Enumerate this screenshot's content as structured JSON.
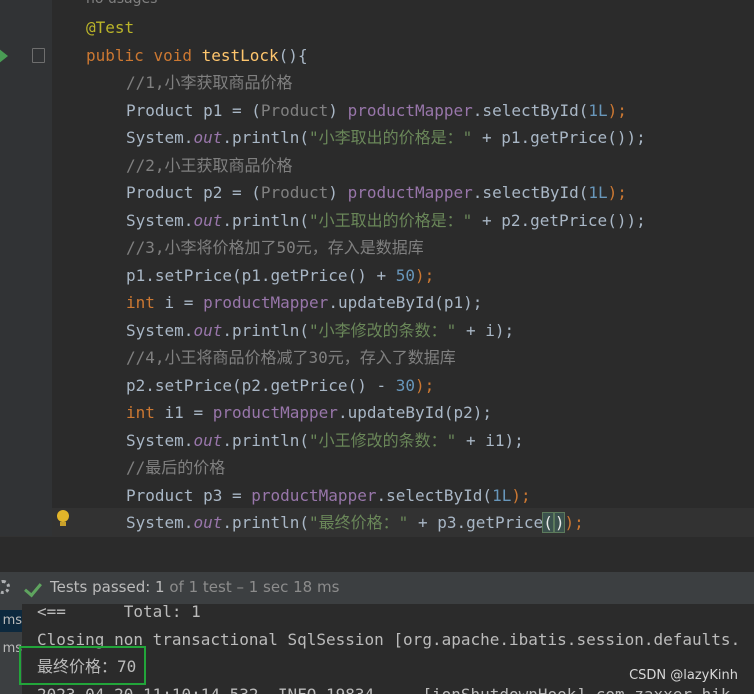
{
  "editor": {
    "hint": "no usages",
    "annotation": "@Test",
    "signature": {
      "kw_public": "public",
      "kw_void": "void",
      "method": "testLock",
      "open": "(){"
    },
    "comment1": "//1,小李获取商品价格",
    "line_p1": {
      "type": "Product p1 = (",
      "cast": "Product",
      "close": ") ",
      "mapper": "productMapper",
      "call": ".selectById(",
      "num": "1L",
      "end": ");"
    },
    "print_p1": {
      "sys": "System.",
      "out": "out",
      "call": ".println(",
      "str": "\"小李取出的价格是：\"",
      "rest": " + p1.getPrice());"
    },
    "comment2": "//2,小王获取商品价格",
    "line_p2": {
      "type": "Product p2 = (",
      "cast": "Product",
      "close": ") ",
      "mapper": "productMapper",
      "call": ".selectById(",
      "num": "1L",
      "end": ");"
    },
    "print_p2": {
      "sys": "System.",
      "out": "out",
      "call": ".println(",
      "str": "\"小王取出的价格是：\"",
      "rest": " + p2.getPrice());"
    },
    "comment3": "//3,小李将价格加了50元，存入是数据库",
    "set_p1": {
      "text": "p1.setPrice(p1.getPrice() + ",
      "num": "50",
      "end": ");"
    },
    "update_p1": {
      "kw": "int",
      "text": " i = ",
      "mapper": "productMapper",
      "rest": ".updateById(p1);"
    },
    "print_i": {
      "sys": "System.",
      "out": "out",
      "call": ".println(",
      "str": "\"小李修改的条数：\"",
      "rest": " + i);"
    },
    "comment4": "//4,小王将商品价格减了30元，存入了数据库",
    "set_p2": {
      "text": "p2.setPrice(p2.getPrice() - ",
      "num": "30",
      "end": ");"
    },
    "update_p2": {
      "kw": "int",
      "text": " i1 = ",
      "mapper": "productMapper",
      "rest": ".updateById(p2);"
    },
    "print_i1": {
      "sys": "System.",
      "out": "out",
      "call": ".println(",
      "str": "\"小王修改的条数：\"",
      "rest": " + i1);"
    },
    "comment5": "//最后的价格",
    "line_p3": {
      "text": "Product p3 = ",
      "mapper": "productMapper",
      "call": ".selectById(",
      "num": "1L",
      "end": ");"
    },
    "print_final": {
      "sys": "System.",
      "out": "out",
      "call": ".println(",
      "str": "\"最终价格：\"",
      "rest": " + p3.getPrice",
      "br_open": "(",
      "br_close": ")",
      "end": ");"
    }
  },
  "test_bar": {
    "status": "Tests passed: ",
    "passed": "1",
    "detail": " of 1 test – 1 sec 18 ms"
  },
  "left_strip": [
    "ms",
    "ms"
  ],
  "console": {
    "lines": [
      "<==      Total: 1",
      "Closing non transactional SqlSession [org.apache.ibatis.session.defaults.",
      "最终价格：70",
      "2023-04-20 11:10:14.532  INFO 19834 --- [ionShutdownHook] com.zaxxer.hik"
    ]
  },
  "watermark": "CSDN @lazyKinh",
  "colors": {
    "editor_bg": "#2b2b2b",
    "keyword": "#cc7832",
    "method": "#ffc66d",
    "string": "#6a8759",
    "number": "#6897bb",
    "field": "#9876aa",
    "pass_green": "#5fa45f",
    "highlight_box": "#22a53a"
  }
}
